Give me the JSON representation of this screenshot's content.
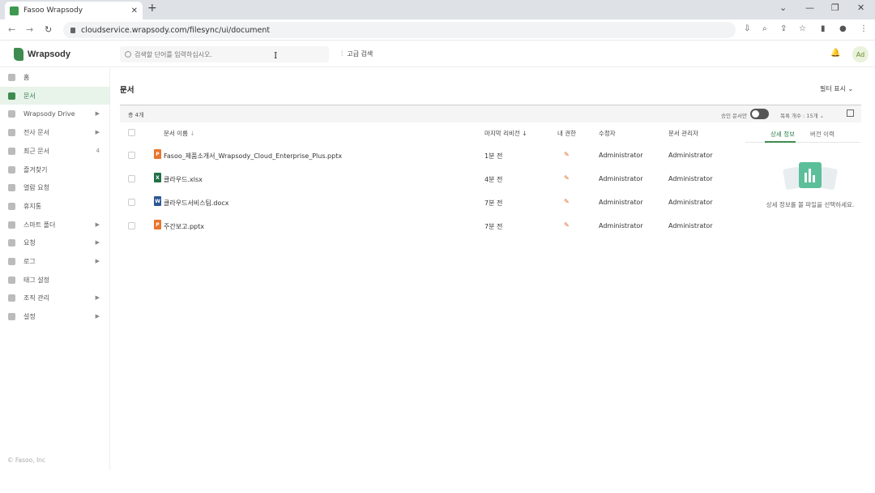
{
  "browser": {
    "tab_title": "Fasoo Wrapsody",
    "tab_close": "✕",
    "new_tab": "+",
    "url": "cloudservice.wrapsody.com/filesync/ui/document",
    "window_controls": [
      "⌄",
      "—",
      "❐",
      "✕"
    ]
  },
  "header": {
    "logo_text": "Wrapsody",
    "search_placeholder": "검색할 단어를 입력하십시오.",
    "advanced_search": "고급 검색",
    "avatar": "Ad"
  },
  "sidebar": {
    "items": [
      {
        "label": "홈",
        "arrow": ""
      },
      {
        "label": "문서",
        "arrow": ""
      },
      {
        "label": "Wrapsody Drive",
        "arrow": "▶"
      },
      {
        "label": "전사 문서",
        "arrow": "▶"
      },
      {
        "label": "최근 문서",
        "count": "4"
      },
      {
        "label": "즐겨찾기",
        "arrow": ""
      },
      {
        "label": "열람 요청",
        "arrow": ""
      },
      {
        "label": "휴지통",
        "arrow": ""
      },
      {
        "label": "스마트 폴더",
        "arrow": "▶"
      },
      {
        "label": "요청",
        "arrow": "▶"
      },
      {
        "label": "로그",
        "arrow": "▶"
      },
      {
        "label": "태그 설정",
        "arrow": ""
      },
      {
        "label": "조직 관리",
        "arrow": "▶"
      },
      {
        "label": "설정",
        "arrow": "▶"
      }
    ],
    "copyright": "© Fasoo, Inc"
  },
  "main": {
    "title": "문서",
    "filter_view": "필터 표시",
    "total": "총 4개",
    "approved_label": "승인 문서만",
    "per_page": "목록 개수 : 15개",
    "columns": {
      "name": "문서 이름",
      "last_revision": "마지막 리비전",
      "my_permission": "내 권한",
      "modifier": "수정자",
      "doc_manager": "문서 관리자"
    },
    "rows": [
      {
        "type": "P",
        "color": "#e8762d",
        "name": "Fasoo_제품소개서_Wrapsody_Cloud_Enterprise_Plus.pptx",
        "revision": "1분 전",
        "modifier": "Administrator",
        "manager": "Administrator"
      },
      {
        "type": "X",
        "color": "#1e7145",
        "name": "클라우드.xlsx",
        "revision": "4분 전",
        "modifier": "Administrator",
        "manager": "Administrator"
      },
      {
        "type": "W",
        "color": "#2b5797",
        "name": "클라우드서비스팀.docx",
        "revision": "7분 전",
        "modifier": "Administrator",
        "manager": "Administrator"
      },
      {
        "type": "P",
        "color": "#e8762d",
        "name": "주간보고.pptx",
        "revision": "7분 전",
        "modifier": "Administrator",
        "manager": "Administrator"
      }
    ]
  },
  "detail": {
    "tab_info": "상세 정보",
    "tab_history": "버전 이력",
    "empty_message": "상세 정보를 볼 파일을 선택하세요."
  }
}
